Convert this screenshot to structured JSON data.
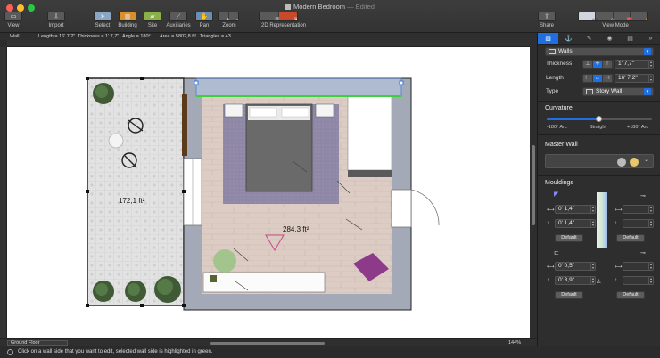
{
  "window": {
    "title": "Modern Bedroom",
    "status": "— Edited"
  },
  "toolbar": {
    "view": "View",
    "import": "Import",
    "select": "Select",
    "building": "Building",
    "site": "Site",
    "auxiliaries": "Auxiliaries",
    "pan": "Pan",
    "zoom": "Zoom",
    "representation": "2D Representation",
    "share": "Share",
    "view_mode": "View Mode"
  },
  "infobar": {
    "kind": "Wall",
    "length": "Length = 16' 7,2\"",
    "thickness": "Thickness = 1' 7,7\"",
    "angle": "Angle = 180°",
    "area": "Area = 5802,8 ft²",
    "triangles": "Triangles = 43"
  },
  "plan": {
    "terrace_area": "172,1 ft²",
    "room_area": "284,3 ft²"
  },
  "bottom": {
    "floor": "Ground Floor",
    "zoom": "144%"
  },
  "status": {
    "text": "Click on a wall side that you want to edit, selected wall side is highlighted in green."
  },
  "inspector": {
    "object_type": "Walls",
    "thickness_label": "Thickness",
    "thickness_value": "1' 7,7\"",
    "length_label": "Length",
    "length_value": "16' 7,2\"",
    "type_label": "Type",
    "type_value": "Story Wall",
    "curvature_label": "Curvature",
    "curvature_min": "-180° Arc",
    "curvature_mid": "Straight",
    "curvature_max": "+180° Arc",
    "curvature_value": 0,
    "master_wall_label": "Master Wall",
    "mouldings_label": "Mouldings",
    "m1_width": "0' 1,4\"",
    "m1_height": "0' 1,4\"",
    "m1_default": "Default",
    "m2_default": "Default",
    "m3_width": "0' 0,5\"",
    "m3_height": "0' 3,9\"",
    "m3_default": "Default",
    "m4_default": "Default"
  },
  "colors": {
    "accent": "#1f6fe0",
    "highlight": "#3cd03c",
    "wall": "#a3a9b6",
    "floor_wood": "#dac9c0",
    "rug": "#938aab"
  }
}
